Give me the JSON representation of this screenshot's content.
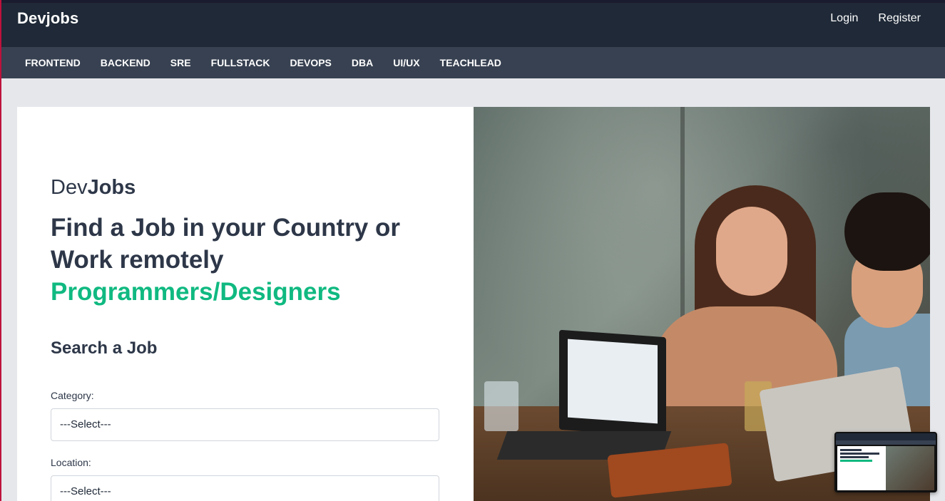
{
  "header": {
    "brand": "Devjobs",
    "login": "Login",
    "register": "Register"
  },
  "categories": [
    "FRONTEND",
    "BACKEND",
    "SRE",
    "FULLSTACK",
    "DEVOPS",
    "DBA",
    "UI/UX",
    "TEACHLEAD"
  ],
  "hero": {
    "logo_part1": "Dev",
    "logo_part2": "Jobs",
    "headline": "Find a Job in your Country or Work remotely",
    "headline_accent": "Programmers/Designers",
    "search_title": "Search a Job",
    "category_label": "Category:",
    "category_value": "---Select---",
    "location_label": "Location:",
    "location_value": "---Select---"
  },
  "colors": {
    "topbar": "#1f2937",
    "catbar": "#374151",
    "accent": "#10b981",
    "text": "#2d3748"
  }
}
